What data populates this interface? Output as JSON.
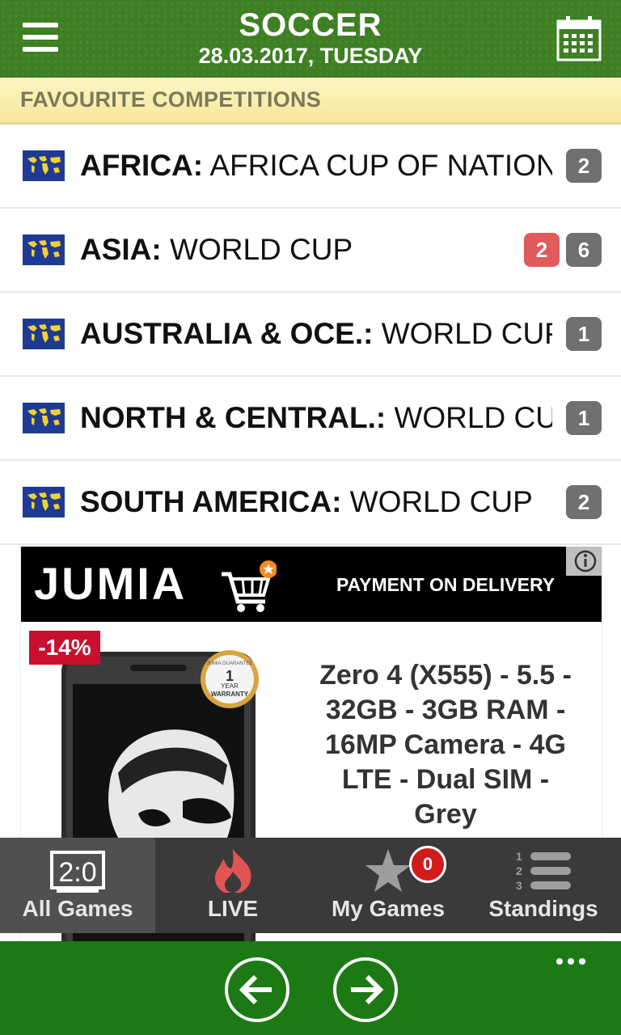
{
  "header": {
    "title": "SOCCER",
    "subtitle": "28.03.2017, TUESDAY",
    "menu_icon": "hamburger-menu-icon",
    "calendar_icon": "calendar-icon"
  },
  "section": {
    "title": "FAVOURITE COMPETITIONS"
  },
  "competitions": [
    {
      "region": "AFRICA:",
      "name": "AFRICA CUP OF NATIONS",
      "live": null,
      "count": "2",
      "flag_icon": "world-map-flag-icon"
    },
    {
      "region": "ASIA:",
      "name": "WORLD CUP",
      "live": "2",
      "count": "6",
      "flag_icon": "world-map-flag-icon"
    },
    {
      "region": "AUSTRALIA & OCE.:",
      "name": "WORLD CUP",
      "live": null,
      "count": "1",
      "flag_icon": "world-map-flag-icon"
    },
    {
      "region": "NORTH & CENTRAL.:",
      "name": "WORLD CUP",
      "live": null,
      "count": "1",
      "flag_icon": "world-map-flag-icon"
    },
    {
      "region": "SOUTH AMERICA:",
      "name": "WORLD CUP",
      "live": null,
      "count": "2",
      "flag_icon": "world-map-flag-icon"
    }
  ],
  "ad": {
    "brand": "JUMIA",
    "tagline": "PAYMENT ON DELIVERY",
    "discount": "-14%",
    "warranty_top": "JUMIA GUARANTEE",
    "warranty_mid": "1",
    "warranty_mid2": "YEAR",
    "warranty_bottom": "WARRANTY",
    "product": "Zero 4 (X555) - 5.5 - 32GB - 3GB RAM - 16MP Camera - 4G LTE - Dual SIM - Grey"
  },
  "tabs": [
    {
      "label": "All Games",
      "icon": "scoreboard-icon",
      "active": true
    },
    {
      "label": "LIVE",
      "icon": "fire-icon",
      "active": false
    },
    {
      "label": "My Games",
      "icon": "star-icon",
      "active": false
    },
    {
      "label": "Standings",
      "icon": "standings-list-icon",
      "active": false
    }
  ],
  "my_games_count": "0",
  "scoreboard_text": "2:0",
  "colors": {
    "header_green": "#3d7f22",
    "bottom_green": "#1c7a14",
    "badge_gray": "#707070",
    "badge_red": "#e05b5b",
    "fire": "#e25454"
  }
}
